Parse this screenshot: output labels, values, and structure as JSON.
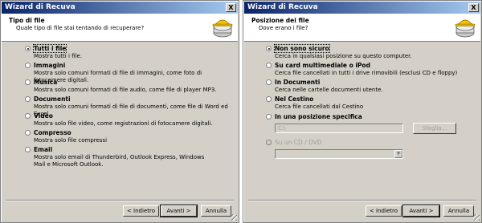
{
  "left": {
    "title": "Wizard di Recuva",
    "close": "X",
    "header_title": "Tipo di file",
    "header_subtitle": "Quale tipo di file stai tentando di recuperare?",
    "options": [
      {
        "label": "Tutti i file",
        "desc": "Mostra tutti i file.",
        "selected": true
      },
      {
        "label": "Immagini",
        "desc": "Mostra solo comuni formati di file di immagini, come foto di fotocamere digitali.",
        "selected": false
      },
      {
        "label": "Musica",
        "desc": "Mostra solo comuni formati di file audio, come file di player MP3.",
        "selected": false
      },
      {
        "label": "Documenti",
        "desc": "Mostra solo comuni formati di file di documenti, come file di Word ed Excel.",
        "selected": false
      },
      {
        "label": "Video",
        "desc": "Mostra solo file video, come registrazioni di fotocamere digitali.",
        "selected": false
      },
      {
        "label": "Compresso",
        "desc": "Mostra solo file compressi",
        "selected": false
      },
      {
        "label": "Email",
        "desc": "Mostra solo email di Thunderbird, Outlook Express, Windows Mail e Microsoft Outlook.",
        "selected": false
      }
    ],
    "buttons": {
      "back": "< Indietro",
      "next": "Avanti >",
      "cancel": "Annulla"
    }
  },
  "right": {
    "title": "Wizard di Recuva",
    "close": "X",
    "header_title": "Posizione dei file",
    "header_subtitle": "Dove erano i file?",
    "options": [
      {
        "label": "Non sono sicuro",
        "desc": "Cerca in qualsiasi posizione su questo computer.",
        "selected": true
      },
      {
        "label": "Su card multimediale o iPod",
        "desc": "Cerca file cancellati in tutti i drive rimovibili (esclusi CD e floppy)",
        "selected": false
      },
      {
        "label": "In Documenti",
        "desc": "Cerca nelle cartelle documenti utente.",
        "selected": false
      },
      {
        "label": "Nel Cestino",
        "desc": "Cerca file cancellati dal Cestino",
        "selected": false
      },
      {
        "label": "In una posizione specifica",
        "desc": "",
        "selected": false
      },
      {
        "label": "Su un CD / DVD",
        "desc": "",
        "selected": false,
        "disabled": true
      }
    ],
    "path_value": "C:\\",
    "browse_label": "Sfoglia...",
    "buttons": {
      "back": "< Indietro",
      "next": "Avanti >",
      "cancel": "Annulla"
    }
  },
  "icons": {
    "logo": "recuva-hardhat-drive-icon",
    "radio": "radio-button",
    "close": "close-icon"
  },
  "colors": {
    "titlebar": "#0a246a",
    "titlebar_end": "#a6caf0",
    "face": "#d4d0c8",
    "logo_yellow": "#f5c400"
  }
}
